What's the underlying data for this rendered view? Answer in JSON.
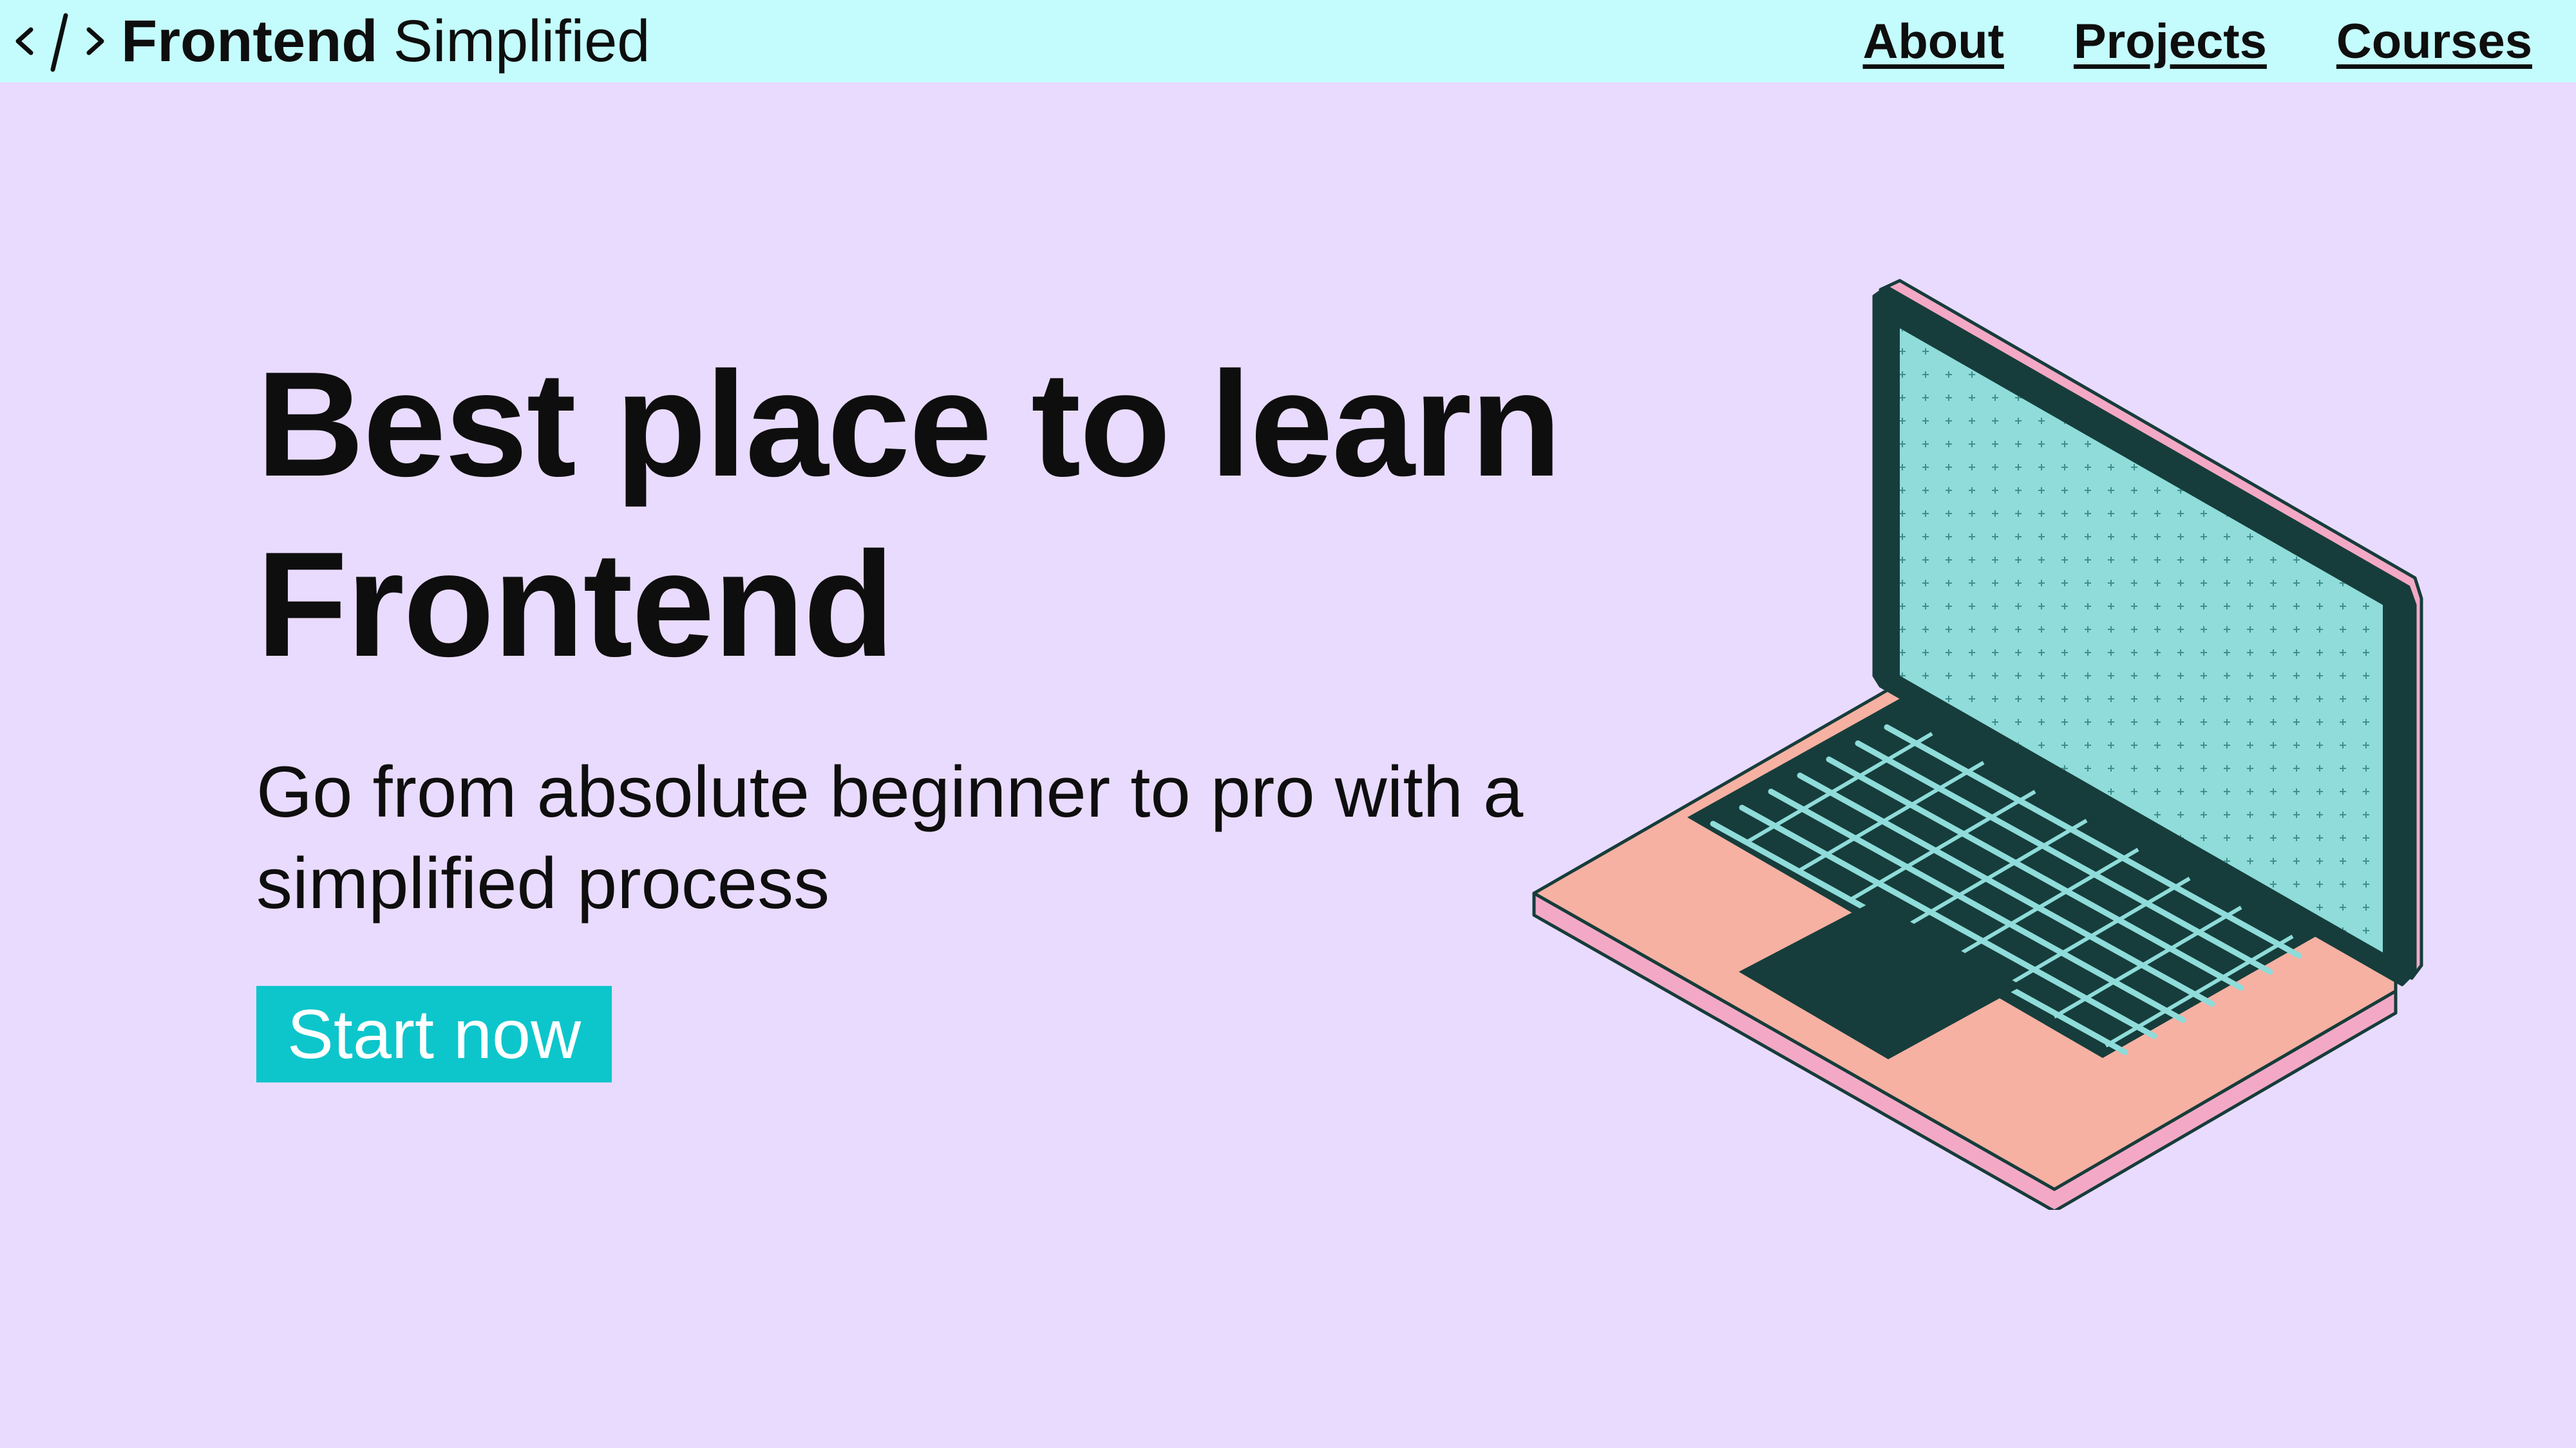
{
  "nav": {
    "logo_code": "</>",
    "logo_bold": "Frontend",
    "logo_light": "Simplified",
    "links": [
      "About",
      "Projects",
      "Courses"
    ]
  },
  "hero": {
    "title_line1": "Best place to learn",
    "title_line2": "Frontend",
    "subtitle_line1": "Go from absolute beginner to pro with a",
    "subtitle_line2": "simplified process",
    "cta_label": "Start now"
  },
  "colors": {
    "nav_bg": "#c4fcfd",
    "page_bg": "#e9dbfe",
    "cta_bg": "#0cc6cb",
    "laptop_body": "#f6b1a2",
    "laptop_edge": "#f3a9c5",
    "laptop_dark": "#163d3b",
    "screen": "#8fdcda"
  },
  "icons": [
    "code-brackets-icon",
    "laptop-illustration"
  ]
}
